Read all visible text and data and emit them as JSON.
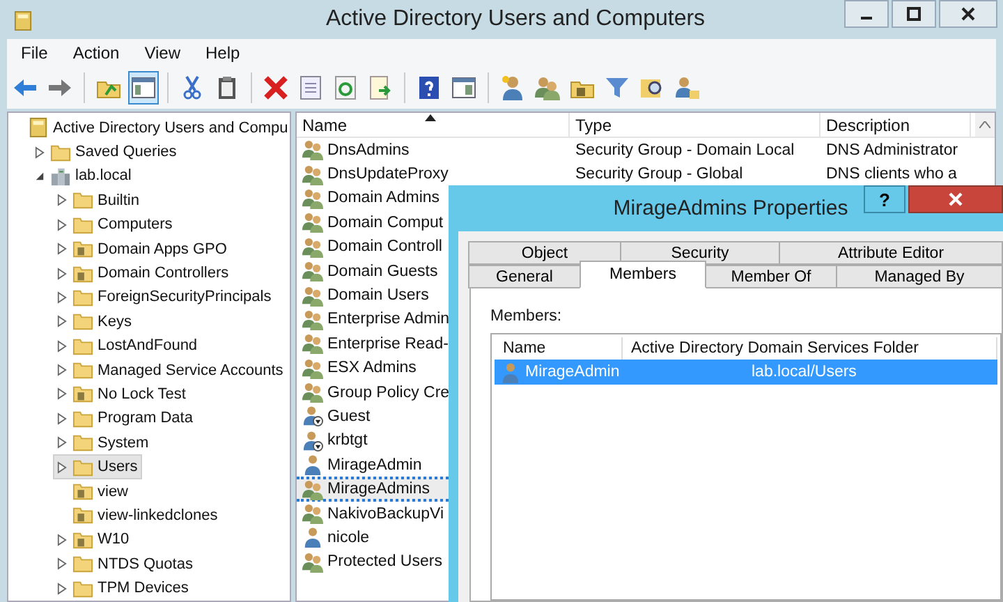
{
  "window": {
    "title": "Active Directory Users and Computers"
  },
  "menu": [
    "File",
    "Action",
    "View",
    "Help"
  ],
  "toolbar": [
    {
      "kind": "back",
      "pressed": false
    },
    {
      "kind": "forward",
      "pressed": false
    },
    {
      "kind": "sep"
    },
    {
      "kind": "up",
      "pressed": false
    },
    {
      "kind": "tree",
      "pressed": true
    },
    {
      "kind": "sep"
    },
    {
      "kind": "cut",
      "pressed": false
    },
    {
      "kind": "paste",
      "pressed": false
    },
    {
      "kind": "sep"
    },
    {
      "kind": "delete",
      "pressed": false
    },
    {
      "kind": "properties",
      "pressed": false
    },
    {
      "kind": "refresh",
      "pressed": false
    },
    {
      "kind": "export",
      "pressed": false
    },
    {
      "kind": "sep"
    },
    {
      "kind": "help",
      "pressed": false
    },
    {
      "kind": "console",
      "pressed": false
    },
    {
      "kind": "sep"
    },
    {
      "kind": "user",
      "pressed": false
    },
    {
      "kind": "group",
      "pressed": false
    },
    {
      "kind": "ou",
      "pressed": false
    },
    {
      "kind": "filter",
      "pressed": false
    },
    {
      "kind": "find",
      "pressed": false
    },
    {
      "kind": "addgroup",
      "pressed": false
    }
  ],
  "tree": {
    "label": "Active Directory Users and Compu",
    "kind": "root",
    "expandable": false,
    "selected": false,
    "children": [
      {
        "label": "Saved Queries",
        "kind": "folder",
        "expandable": true,
        "selected": false
      },
      {
        "label": "lab.local",
        "kind": "domain",
        "expandable": true,
        "expanded": true,
        "selected": false,
        "children": [
          {
            "label": "Builtin",
            "kind": "folder",
            "expandable": true,
            "selected": false
          },
          {
            "label": "Computers",
            "kind": "folder",
            "expandable": true,
            "selected": false
          },
          {
            "label": "Domain Apps GPO",
            "kind": "ou",
            "expandable": true,
            "selected": false
          },
          {
            "label": "Domain Controllers",
            "kind": "ou",
            "expandable": true,
            "selected": false
          },
          {
            "label": "ForeignSecurityPrincipals",
            "kind": "folder",
            "expandable": true,
            "selected": false
          },
          {
            "label": "Keys",
            "kind": "folder",
            "expandable": true,
            "selected": false
          },
          {
            "label": "LostAndFound",
            "kind": "folder",
            "expandable": true,
            "selected": false
          },
          {
            "label": "Managed Service Accounts",
            "kind": "folder",
            "expandable": true,
            "selected": false
          },
          {
            "label": "No Lock Test",
            "kind": "ou",
            "expandable": true,
            "selected": false
          },
          {
            "label": "Program Data",
            "kind": "folder",
            "expandable": true,
            "selected": false
          },
          {
            "label": "System",
            "kind": "folder",
            "expandable": true,
            "selected": false
          },
          {
            "label": "Users",
            "kind": "folder",
            "expandable": true,
            "selected": true
          },
          {
            "label": "view",
            "kind": "ou",
            "expandable": false,
            "selected": false
          },
          {
            "label": "view-linkedclones",
            "kind": "ou",
            "expandable": false,
            "selected": false
          },
          {
            "label": "W10",
            "kind": "ou",
            "expandable": true,
            "selected": false
          },
          {
            "label": "NTDS Quotas",
            "kind": "folder",
            "expandable": true,
            "selected": false
          },
          {
            "label": "TPM Devices",
            "kind": "folder",
            "expandable": true,
            "selected": false
          }
        ]
      }
    ]
  },
  "list": {
    "columns": [
      {
        "label": "Name",
        "sorted": true
      },
      {
        "label": "Type",
        "sorted": false
      },
      {
        "label": "Description",
        "sorted": false
      }
    ],
    "rows": [
      {
        "name": "DnsAdmins",
        "type": "Security Group - Domain Local",
        "description": "DNS Administrator",
        "kind": "group",
        "selected": false
      },
      {
        "name": "DnsUpdateProxy",
        "type": "Security Group - Global",
        "description": "DNS clients who a",
        "kind": "group",
        "selected": false
      },
      {
        "name": "Domain Admins",
        "kind": "group",
        "selected": false
      },
      {
        "name": "Domain Comput",
        "kind": "group",
        "selected": false
      },
      {
        "name": "Domain Controll",
        "kind": "group",
        "selected": false
      },
      {
        "name": "Domain Guests",
        "kind": "group",
        "selected": false
      },
      {
        "name": "Domain Users",
        "kind": "group",
        "selected": false
      },
      {
        "name": "Enterprise Admin",
        "kind": "group",
        "selected": false
      },
      {
        "name": "Enterprise Read-",
        "kind": "group",
        "selected": false
      },
      {
        "name": "ESX Admins",
        "kind": "group",
        "selected": false
      },
      {
        "name": "Group Policy Cre",
        "kind": "group",
        "selected": false
      },
      {
        "name": "Guest",
        "kind": "user-disabled",
        "selected": false
      },
      {
        "name": "krbtgt",
        "kind": "user-disabled",
        "selected": false
      },
      {
        "name": "MirageAdmin",
        "kind": "user",
        "selected": false
      },
      {
        "name": "MirageAdmins",
        "kind": "group",
        "selected": true
      },
      {
        "name": "NakivoBackupVi",
        "kind": "group",
        "selected": false
      },
      {
        "name": "nicole",
        "kind": "user",
        "selected": false
      },
      {
        "name": "Protected Users",
        "kind": "group",
        "selected": false
      }
    ]
  },
  "dialog": {
    "title": "MirageAdmins Properties",
    "help_button": "?",
    "tab_rows": [
      {
        "tabs": [
          {
            "label": "Object",
            "selected": false
          },
          {
            "label": "Security",
            "selected": false
          },
          {
            "label": "Attribute Editor",
            "selected": false
          }
        ]
      },
      {
        "tabs": [
          {
            "label": "General",
            "selected": false
          },
          {
            "label": "Members",
            "selected": true
          },
          {
            "label": "Member Of",
            "selected": false
          },
          {
            "label": "Managed By",
            "selected": false
          }
        ]
      }
    ],
    "members_label": "Members:",
    "members": {
      "columns": [
        "Name",
        "Active Directory Domain Services Folder"
      ],
      "rows": [
        {
          "name": "MirageAdmin",
          "folder": "lab.local/Users",
          "selected": true
        }
      ]
    }
  }
}
